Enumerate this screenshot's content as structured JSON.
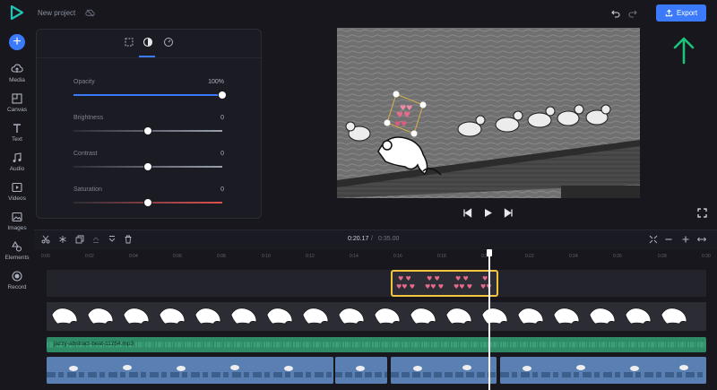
{
  "header": {
    "project_title": "New project",
    "export_label": "Export"
  },
  "sidebar": {
    "add_label": "+",
    "items": [
      {
        "label": "Media",
        "icon": "cloud-upload-icon"
      },
      {
        "label": "Canvas",
        "icon": "canvas-icon"
      },
      {
        "label": "Text",
        "icon": "text-icon"
      },
      {
        "label": "Audio",
        "icon": "music-note-icon"
      },
      {
        "label": "Videos",
        "icon": "video-icon"
      },
      {
        "label": "Images",
        "icon": "image-icon"
      },
      {
        "label": "Elements",
        "icon": "shapes-icon"
      },
      {
        "label": "Record",
        "icon": "record-icon"
      }
    ]
  },
  "panel": {
    "tabs": [
      "crop-icon",
      "adjust-icon",
      "speed-icon"
    ],
    "active_tab": "adjust-icon",
    "sliders": [
      {
        "name": "Opacity",
        "value": "100%",
        "level": 1.0,
        "color": "#3b7bfb"
      },
      {
        "name": "Brightness",
        "value": "0",
        "level": 0.5,
        "color": "#9aa0ad"
      },
      {
        "name": "Contrast",
        "value": "0",
        "level": 0.5,
        "color": "#9aa0ad"
      },
      {
        "name": "Saturation",
        "value": "0",
        "level": 0.5,
        "color": "#e0504f"
      }
    ]
  },
  "timeline": {
    "current_time": "0:20.17",
    "separator": "/",
    "total_time": "0:35.00",
    "ticks": [
      "0:00",
      "0:02",
      "0:04",
      "0:06",
      "0:08",
      "0:10",
      "0:12",
      "0:14",
      "0:16",
      "0:18",
      "0:20",
      "0:22",
      "0:24",
      "0:26",
      "0:28",
      "0:30",
      "0:32"
    ],
    "audio_track": "jazzy-abstract-beat-11254.mp3"
  },
  "colors": {
    "accent": "#3b7bfb",
    "audio": "#2f8a66",
    "selection": "#f5c53f",
    "arrow": "#1ec27a"
  }
}
